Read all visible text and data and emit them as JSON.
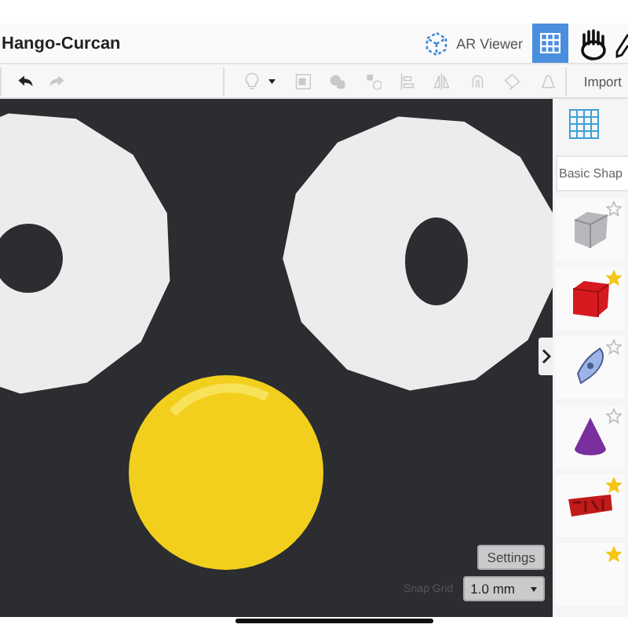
{
  "header": {
    "title": "Hango-Curcan",
    "ar_viewer": "AR Viewer",
    "grid_view": {
      "selected": true
    }
  },
  "toolbar": {
    "undo": {
      "disabled": false
    },
    "redo": {
      "disabled": true
    },
    "import": "Import"
  },
  "sidebar": {
    "category": "Basic Shap",
    "shapes": [
      {
        "kind": "box",
        "starred": false
      },
      {
        "kind": "cube",
        "starred": true
      },
      {
        "kind": "pen",
        "starred": false
      },
      {
        "kind": "cone",
        "starred": false
      },
      {
        "kind": "text",
        "starred": true
      },
      {
        "kind": "partial",
        "starred": true
      }
    ]
  },
  "viewport": {
    "settings": "Settings",
    "snap_grid_label": "Snap Grid",
    "snap_grid_value": "1.0 mm"
  }
}
